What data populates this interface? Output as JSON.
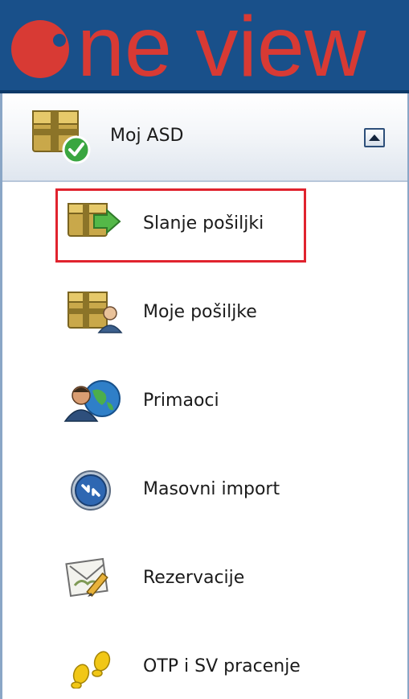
{
  "header": {
    "logo_text": "ne view",
    "colors": {
      "background": "#19508a",
      "logo": "#d83a34"
    }
  },
  "section": {
    "title": "Moj ASD",
    "icon": "package-check-icon",
    "collapse_icon": "chevron-up-icon"
  },
  "menu": {
    "items": [
      {
        "label": "Slanje pošiljki",
        "icon": "package-send-icon",
        "highlighted": true
      },
      {
        "label": "Moje pošiljke",
        "icon": "package-user-icon"
      },
      {
        "label": "Primaoci",
        "icon": "users-globe-icon"
      },
      {
        "label": "Masovni import",
        "icon": "import-arrows-icon"
      },
      {
        "label": "Rezervacije",
        "icon": "reservation-pencil-icon"
      },
      {
        "label": "OTP i SV pracenje",
        "icon": "footprints-icon"
      }
    ]
  },
  "colors": {
    "highlight_border": "#e0232e",
    "panel_border": "#8aa6c6"
  }
}
